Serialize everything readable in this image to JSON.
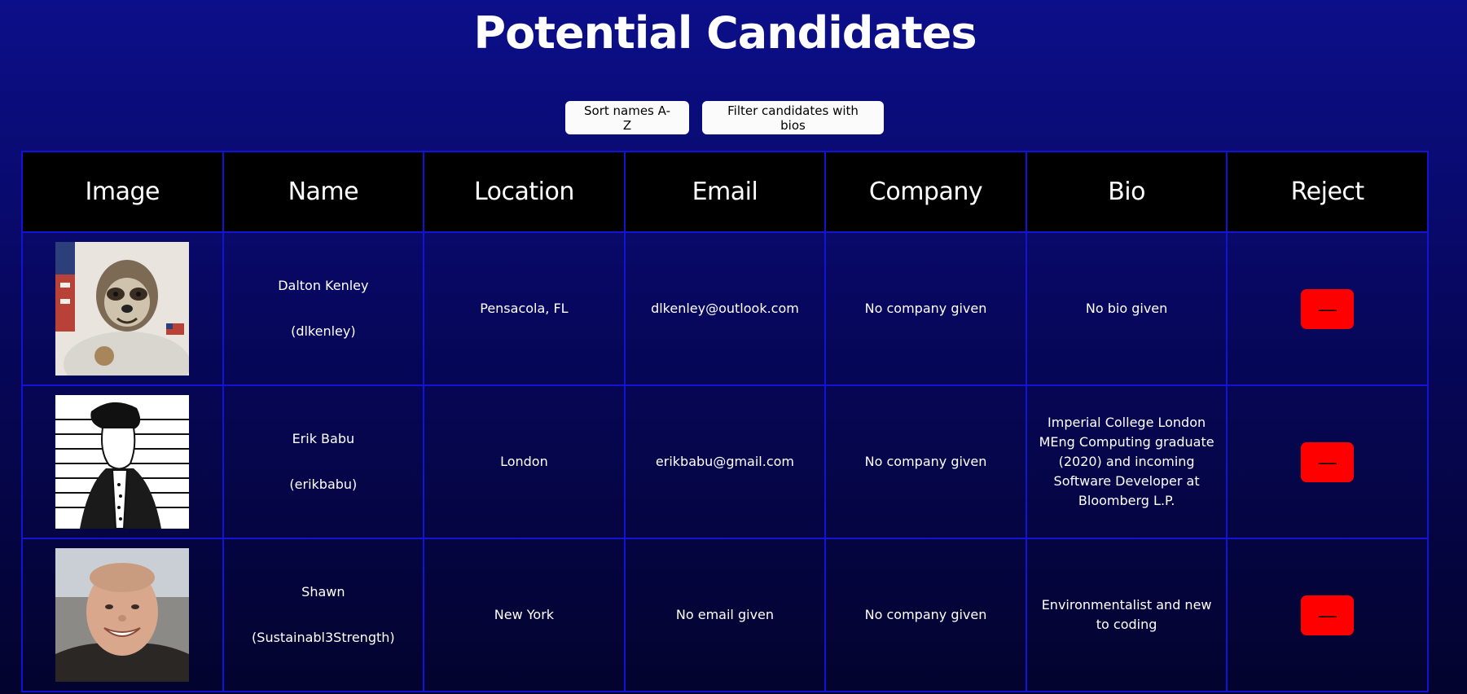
{
  "header": {
    "title": "Potential Candidates"
  },
  "toolbar": {
    "sort_label": "Sort names A-Z",
    "filter_label": "Filter candidates with bios"
  },
  "table": {
    "columns": [
      "Image",
      "Name",
      "Location",
      "Email",
      "Company",
      "Bio",
      "Reject"
    ],
    "rows": [
      {
        "image": "sloth-astronaut-photo",
        "name": "Dalton Kenley",
        "username": "(dlkenley)",
        "location": "Pensacola, FL",
        "email": "dlkenley@outlook.com",
        "company": "No company given",
        "bio": "No bio given",
        "reject_label": "—"
      },
      {
        "image": "sketch-portrait",
        "name": "Erik Babu",
        "username": "(erikbabu)",
        "location": "London",
        "email": "erikbabu@gmail.com",
        "company": "No company given",
        "bio": "Imperial College London MEng Computing graduate (2020) and incoming Software Developer at Bloomberg L.P.",
        "reject_label": "—"
      },
      {
        "image": "smiling-man-photo",
        "name": "Shawn",
        "username": "(Sustainabl3Strength)",
        "location": "New York",
        "email": "No email given",
        "company": "No company given",
        "bio": "Environmentalist and new to coding",
        "reject_label": "—"
      }
    ]
  },
  "colors": {
    "background_top": "#0c0f8a",
    "background_bottom": "#03032e",
    "grid_border": "#1313d6",
    "header_bg": "#000000",
    "reject_button": "#ff0000"
  }
}
